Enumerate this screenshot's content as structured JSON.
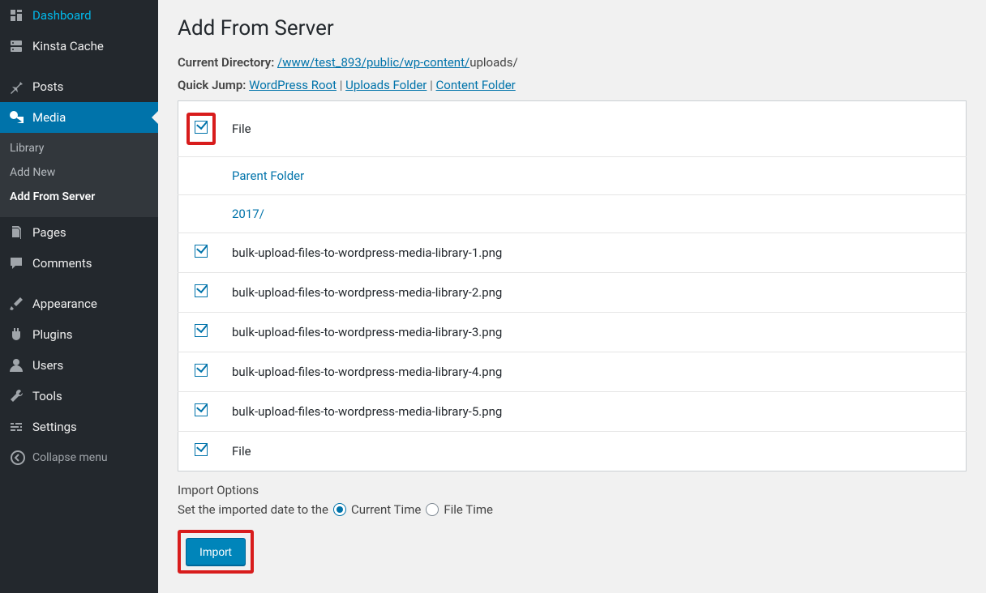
{
  "sidebar": {
    "items": [
      {
        "label": "Dashboard",
        "icon": "dashboard"
      },
      {
        "label": "Kinsta Cache",
        "icon": "server"
      },
      {
        "label": "Posts",
        "icon": "pin"
      },
      {
        "label": "Media",
        "icon": "media",
        "active": true,
        "sub": [
          {
            "label": "Library"
          },
          {
            "label": "Add New"
          },
          {
            "label": "Add From Server",
            "current": true
          }
        ]
      },
      {
        "label": "Pages",
        "icon": "page"
      },
      {
        "label": "Comments",
        "icon": "comment"
      },
      {
        "label": "Appearance",
        "icon": "brush"
      },
      {
        "label": "Plugins",
        "icon": "plug"
      },
      {
        "label": "Users",
        "icon": "user"
      },
      {
        "label": "Tools",
        "icon": "wrench"
      },
      {
        "label": "Settings",
        "icon": "sliders"
      }
    ],
    "collapse_label": "Collapse menu"
  },
  "page": {
    "title": "Add From Server",
    "current_directory_label": "Current Directory:",
    "current_directory_path_link": "/www/test_893/public/wp-content/",
    "current_directory_path_tail": "uploads/",
    "quick_jump_label": "Quick Jump:",
    "quick_jump_links": [
      "WordPress Root",
      "Uploads Folder",
      "Content Folder"
    ]
  },
  "filelist": {
    "header_label": "File",
    "parent_folder_label": "Parent Folder",
    "folders": [
      "2017/"
    ],
    "files": [
      "bulk-upload-files-to-wordpress-media-library-1.png",
      "bulk-upload-files-to-wordpress-media-library-2.png",
      "bulk-upload-files-to-wordpress-media-library-3.png",
      "bulk-upload-files-to-wordpress-media-library-4.png",
      "bulk-upload-files-to-wordpress-media-library-5.png"
    ],
    "footer_label": "File"
  },
  "import_options": {
    "title": "Import Options",
    "date_label": "Set the imported date to the",
    "radios": [
      "Current Time",
      "File Time"
    ],
    "selected": 0,
    "button_label": "Import"
  }
}
